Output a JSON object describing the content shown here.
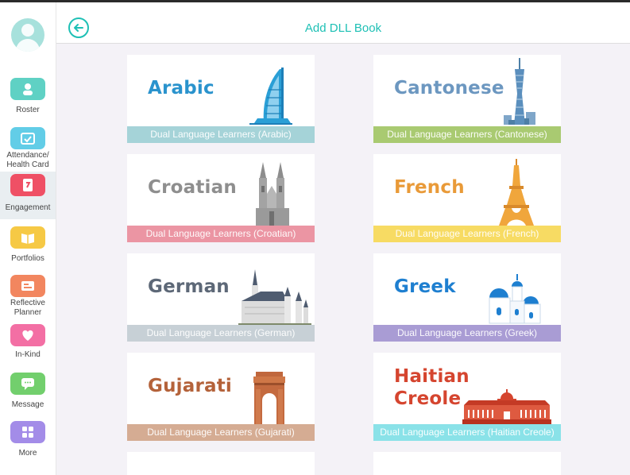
{
  "header": {
    "title": "Add DLL Book"
  },
  "sidebar": {
    "items": [
      {
        "label": "Roster",
        "color": "#5fd1c4"
      },
      {
        "label": "Attendance/ Health Card",
        "color": "#62cde7"
      },
      {
        "label": "Engagement",
        "color": "#ef5065"
      },
      {
        "label": "Portfolios",
        "color": "#f6c945"
      },
      {
        "label": "Reflective Planner",
        "color": "#f2865f"
      },
      {
        "label": "In-Kind",
        "color": "#f36fa4"
      },
      {
        "label": "Message",
        "color": "#72cf6d"
      },
      {
        "label": "More",
        "color": "#a38ce8"
      }
    ]
  },
  "books": [
    {
      "name": "Arabic",
      "strip": "Dual Language Learners (Arabic)",
      "name_color": "#2a93cd",
      "strip_color": "#a5d3d8"
    },
    {
      "name": "Cantonese",
      "strip": "Dual Language Learners (Cantonese)",
      "name_color": "#6c97c0",
      "strip_color": "#a9ca71"
    },
    {
      "name": "Croatian",
      "strip": "Dual Language Learners (Croatian)",
      "name_color": "#8e8e8e",
      "strip_color": "#eb95a3"
    },
    {
      "name": "French",
      "strip": "Dual Language Learners (French)",
      "name_color": "#e99a38",
      "strip_color": "#f7db63"
    },
    {
      "name": "German",
      "strip": "Dual Language Learners (German)",
      "name_color": "#5d6877",
      "strip_color": "#c7d0d6"
    },
    {
      "name": "Greek",
      "strip": "Dual Language Learners (Greek)",
      "name_color": "#1e7fd0",
      "strip_color": "#a99cd4"
    },
    {
      "name": "Gujarati",
      "strip": "Dual Language Learners (Gujarati)",
      "name_color": "#b4623a",
      "strip_color": "#d5ac93"
    },
    {
      "name": "Haitian Creole",
      "name_line1": "Haitian",
      "name_line2": "Creole",
      "strip": "Dual Language Learners (Haitian Creole)",
      "name_color": "#d5452f",
      "strip_color": "#8ae2e8"
    }
  ]
}
